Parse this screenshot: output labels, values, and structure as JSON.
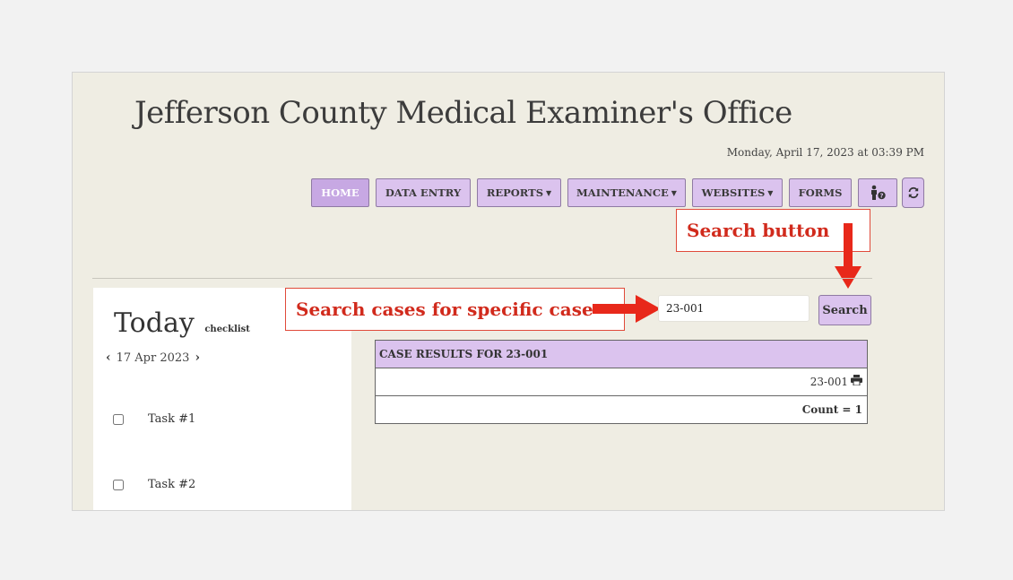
{
  "header": {
    "title": "Jefferson County Medical Examiner's Office",
    "datetime": "Monday, April 17, 2023 at 03:39 PM"
  },
  "nav": {
    "home": "HOME",
    "data_entry": "DATA ENTRY",
    "reports": "REPORTS",
    "maintenance": "MAINTENANCE",
    "websites": "WEBSITES",
    "forms": "FORMS",
    "help_icon": "person-help-icon",
    "refresh_icon": "refresh-icon"
  },
  "today_panel": {
    "heading": "Today",
    "subheading": "checklist",
    "date": "17 Apr 2023",
    "tasks": [
      "Task #1",
      "Task #2"
    ]
  },
  "search": {
    "value": "23-001",
    "button_label": "Search"
  },
  "results": {
    "header": "CASE RESULTS FOR 23-001",
    "case_number": "23-001",
    "count": "Count = 1"
  },
  "annotations": {
    "search_button": "Search button",
    "search_cases": "Search cases for specific case"
  },
  "colors": {
    "accent": "#dbc3ee",
    "background": "#efede3",
    "annotation_red": "#e8281a"
  }
}
